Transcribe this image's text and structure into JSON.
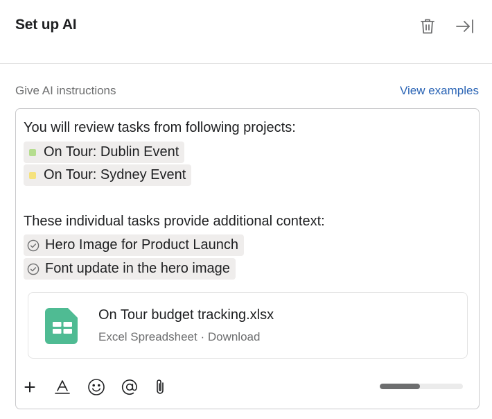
{
  "header": {
    "title": "Set up AI",
    "trash_icon": "trash-icon",
    "close_icon": "collapse-right-icon"
  },
  "instructions": {
    "label": "Give AI instructions",
    "examples_link": "View examples"
  },
  "editor": {
    "projects_intro": "You will review tasks from following projects:",
    "projects": [
      {
        "name": "On Tour: Dublin Event",
        "color": "#b5dd8f"
      },
      {
        "name": "On Tour: Sydney Event",
        "color": "#f5e27d"
      }
    ],
    "tasks_intro": "These individual tasks provide additional context:",
    "tasks": [
      {
        "name": "Hero Image for Product Launch",
        "icon": "check-circle-icon"
      },
      {
        "name": "Font update in the hero image",
        "icon": "check-circle-icon"
      }
    ],
    "attachment": {
      "file_name": "On Tour budget tracking.xlsx",
      "file_type": "Excel Spreadsheet",
      "separator": "·",
      "action": "Download",
      "icon": "spreadsheet-icon",
      "icon_color": "#4fbb93"
    },
    "toolbar": {
      "tools": [
        "plus-icon",
        "text-format-icon",
        "emoji-icon",
        "mention-icon",
        "attachment-icon"
      ],
      "progress": 0.48
    }
  },
  "colors": {
    "link": "#2a64b5",
    "muted_text": "#6d6e6f",
    "chip_bg": "#efedec",
    "border": "#c9c9cb"
  }
}
